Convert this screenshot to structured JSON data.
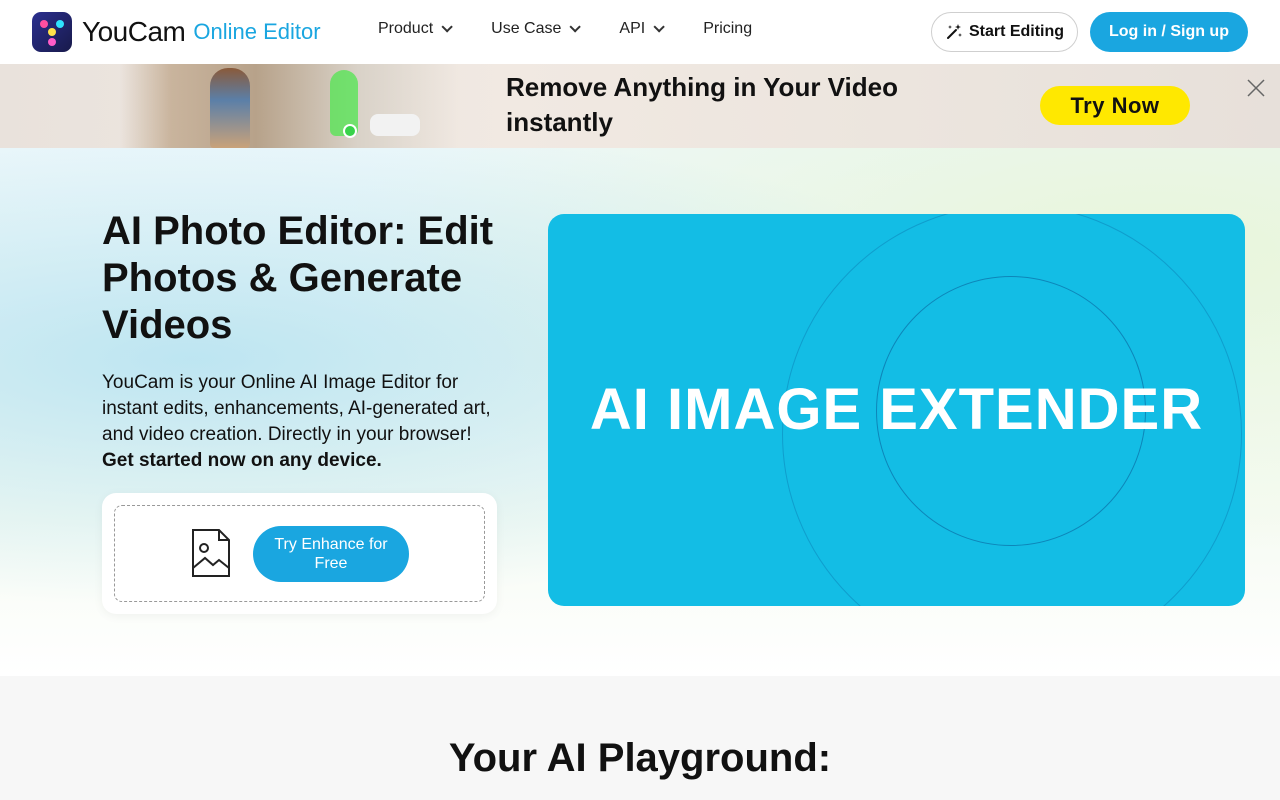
{
  "header": {
    "logo_name": "YouCam",
    "logo_sub": "Online Editor",
    "nav": [
      {
        "label": "Product",
        "has_dropdown": true
      },
      {
        "label": "Use Case",
        "has_dropdown": true
      },
      {
        "label": "API",
        "has_dropdown": true
      },
      {
        "label": "Pricing",
        "has_dropdown": false
      }
    ],
    "start_editing": "Start Editing",
    "login": "Log in / Sign up"
  },
  "banner": {
    "title": "Remove Anything in Your Video instantly",
    "cta": "Try Now"
  },
  "hero": {
    "title": "AI Photo Editor: Edit Photos & Generate Videos",
    "description": "YouCam is your Online AI Image Editor for instant edits, enhancements, AI-generated art, and video creation. Directly in your browser! ",
    "description_bold": "Get started now on any device.",
    "upload_button": "Try Enhance for Free",
    "feature_text": "AI IMAGE EXTENDER"
  },
  "section": {
    "title": "Your AI Playground:"
  },
  "colors": {
    "accent": "#1aa6e0",
    "banner_cta": "#ffe800",
    "feature_bg": "#13bde5"
  }
}
